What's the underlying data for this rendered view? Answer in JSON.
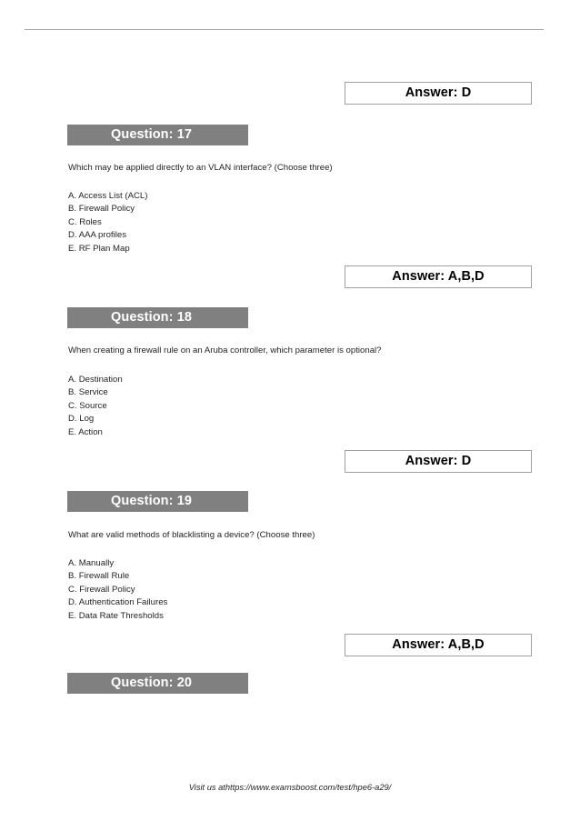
{
  "page": {
    "top_rule": true,
    "footer_text": "Visit us athttps://www.examsboost.com/test/hpe6-a29/",
    "band_color": "#808080",
    "band_text_color": "#ffffff",
    "answer_border_color": "#a0a0a0",
    "rule_color": "#a6a6a6"
  },
  "answers": {
    "a16": "Answer: D",
    "a17": "Answer: A,B,D",
    "a18": "Answer: D",
    "a19": "Answer: A,B,D"
  },
  "questions": [
    {
      "header": "Question: 17",
      "prompt": "Which may be applied directly to an VLAN interface? (Choose three)",
      "options": [
        "A. Access List (ACL)",
        "B. Firewall Policy",
        "C. Roles",
        "D. AAA profiles",
        "E. RF Plan Map"
      ]
    },
    {
      "header": "Question: 18",
      "prompt": "When creating a firewall rule on an Aruba controller, which parameter is optional?",
      "options": [
        "A. Destination",
        "B. Service",
        "C. Source",
        "D. Log",
        "E. Action"
      ]
    },
    {
      "header": "Question: 19",
      "prompt": "What are valid methods of blacklisting a device? (Choose three)",
      "options": [
        "A. Manually",
        "B. Firewall Rule",
        "C. Firewall Policy",
        "D. Authentication Failures",
        "E. Data Rate Thresholds"
      ]
    },
    {
      "header": "Question: 20",
      "prompt": "",
      "options": []
    }
  ]
}
